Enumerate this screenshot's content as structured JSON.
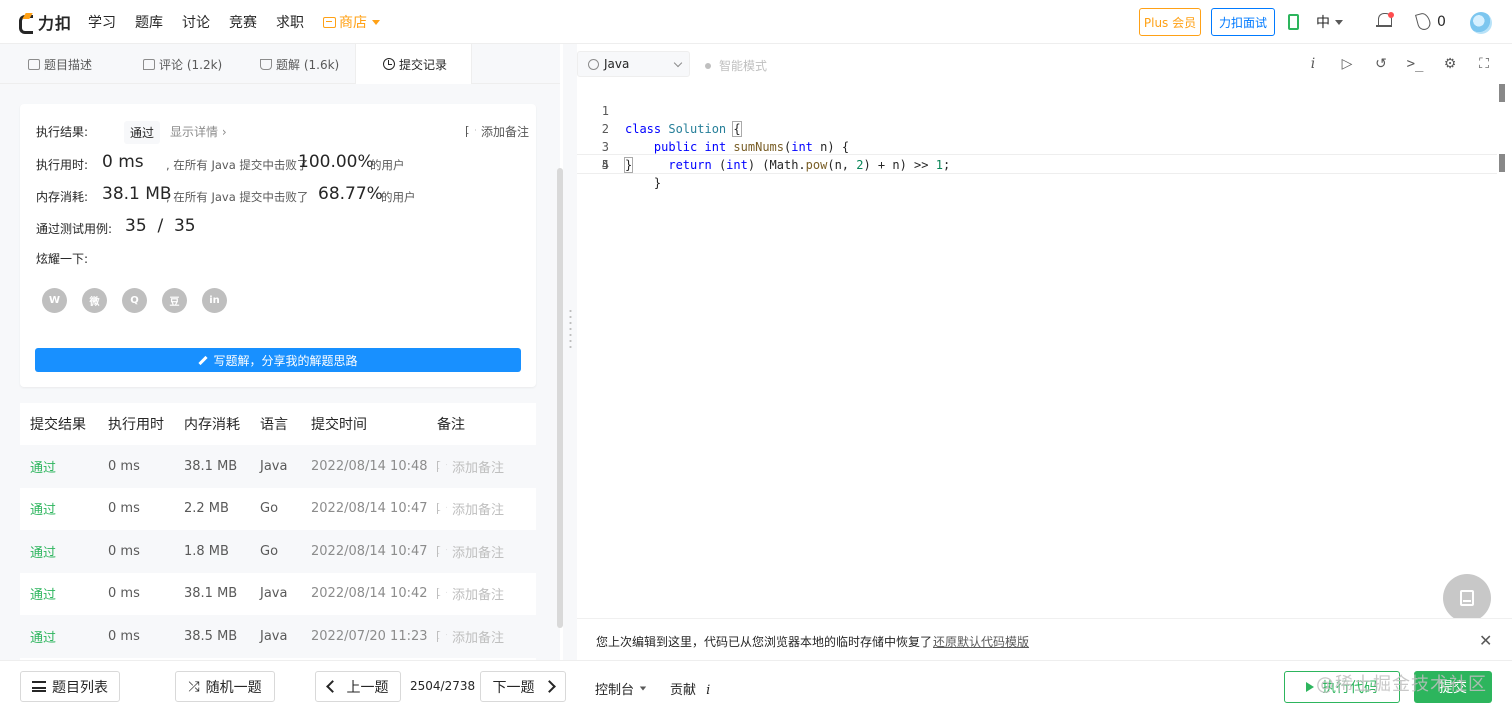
{
  "nav": {
    "logo_text": "力扣",
    "links": [
      "学习",
      "题库",
      "讨论",
      "竞赛",
      "求职"
    ],
    "shop": "商店",
    "plus_btn": "Plus 会员",
    "interview_btn": "力扣面试",
    "lang": "中",
    "flame_count": "0"
  },
  "tabs": [
    {
      "label": "题目描述"
    },
    {
      "label": "评论 (1.2k)"
    },
    {
      "label": "题解 (1.6k)"
    },
    {
      "label": "提交记录"
    }
  ],
  "result": {
    "exec_result_label": "执行结果:",
    "status": "通过",
    "detail_link": "显示详情 ›",
    "add_note": "添加备注",
    "time_label": "执行用时:",
    "time_value": "0 ms",
    "time_desc": ", 在所有 Java 提交中击败了",
    "time_pct": "100.00%",
    "time_users": "的用户",
    "mem_label": "内存消耗:",
    "mem_value": "38.1 MB",
    "mem_desc": ", 在所有 Java 提交中击败了",
    "mem_pct": "68.77%",
    "mem_users": "的用户",
    "tests_label": "通过测试用例:",
    "tests_value": "35  /  35",
    "share_label": "炫耀一下:",
    "share_icons": [
      "wechat-icon",
      "weibo-icon",
      "qq-icon",
      "douban-icon",
      "linkedin-icon"
    ],
    "share_glyphs": [
      "W",
      "微",
      "Q",
      "豆",
      "in"
    ],
    "write_btn": "写题解，分享我的解题思路"
  },
  "table": {
    "headers": [
      "提交结果",
      "执行用时",
      "内存消耗",
      "语言",
      "提交时间",
      "备注"
    ],
    "rows": [
      {
        "result": "通过",
        "time": "0 ms",
        "mem": "38.1 MB",
        "lang": "Java",
        "date": "2022/08/14 10:48",
        "note": "添加备注"
      },
      {
        "result": "通过",
        "time": "0 ms",
        "mem": "2.2 MB",
        "lang": "Go",
        "date": "2022/08/14 10:47",
        "note": "添加备注"
      },
      {
        "result": "通过",
        "time": "0 ms",
        "mem": "1.8 MB",
        "lang": "Go",
        "date": "2022/08/14 10:47",
        "note": "添加备注"
      },
      {
        "result": "通过",
        "time": "0 ms",
        "mem": "38.1 MB",
        "lang": "Java",
        "date": "2022/08/14 10:42",
        "note": "添加备注"
      },
      {
        "result": "通过",
        "time": "0 ms",
        "mem": "38.5 MB",
        "lang": "Java",
        "date": "2022/07/20 11:23",
        "note": "添加备注"
      }
    ]
  },
  "editor": {
    "language": "Java",
    "smart_mode": "智能模式",
    "line_numbers": [
      "1",
      "2",
      "3",
      "4",
      "5"
    ]
  },
  "restore": {
    "text": "您上次编辑到这里，代码已从您浏览器本地的临时存储中恢复了",
    "link": "还原默认代码模版"
  },
  "bottom": {
    "problem_list": "题目列表",
    "random": "随机一题",
    "prev": "上一题",
    "pager": "2504/2738",
    "next": "下一题",
    "console": "控制台",
    "contribute": "贡献",
    "run": "执行代码",
    "submit": "提交",
    "watermark": "@稀土掘金技术社区"
  },
  "colors": {
    "accent_orange": "#ffa116",
    "accent_blue": "#007aff",
    "success_green": "#2db55d",
    "primary_blue": "#1890ff"
  }
}
